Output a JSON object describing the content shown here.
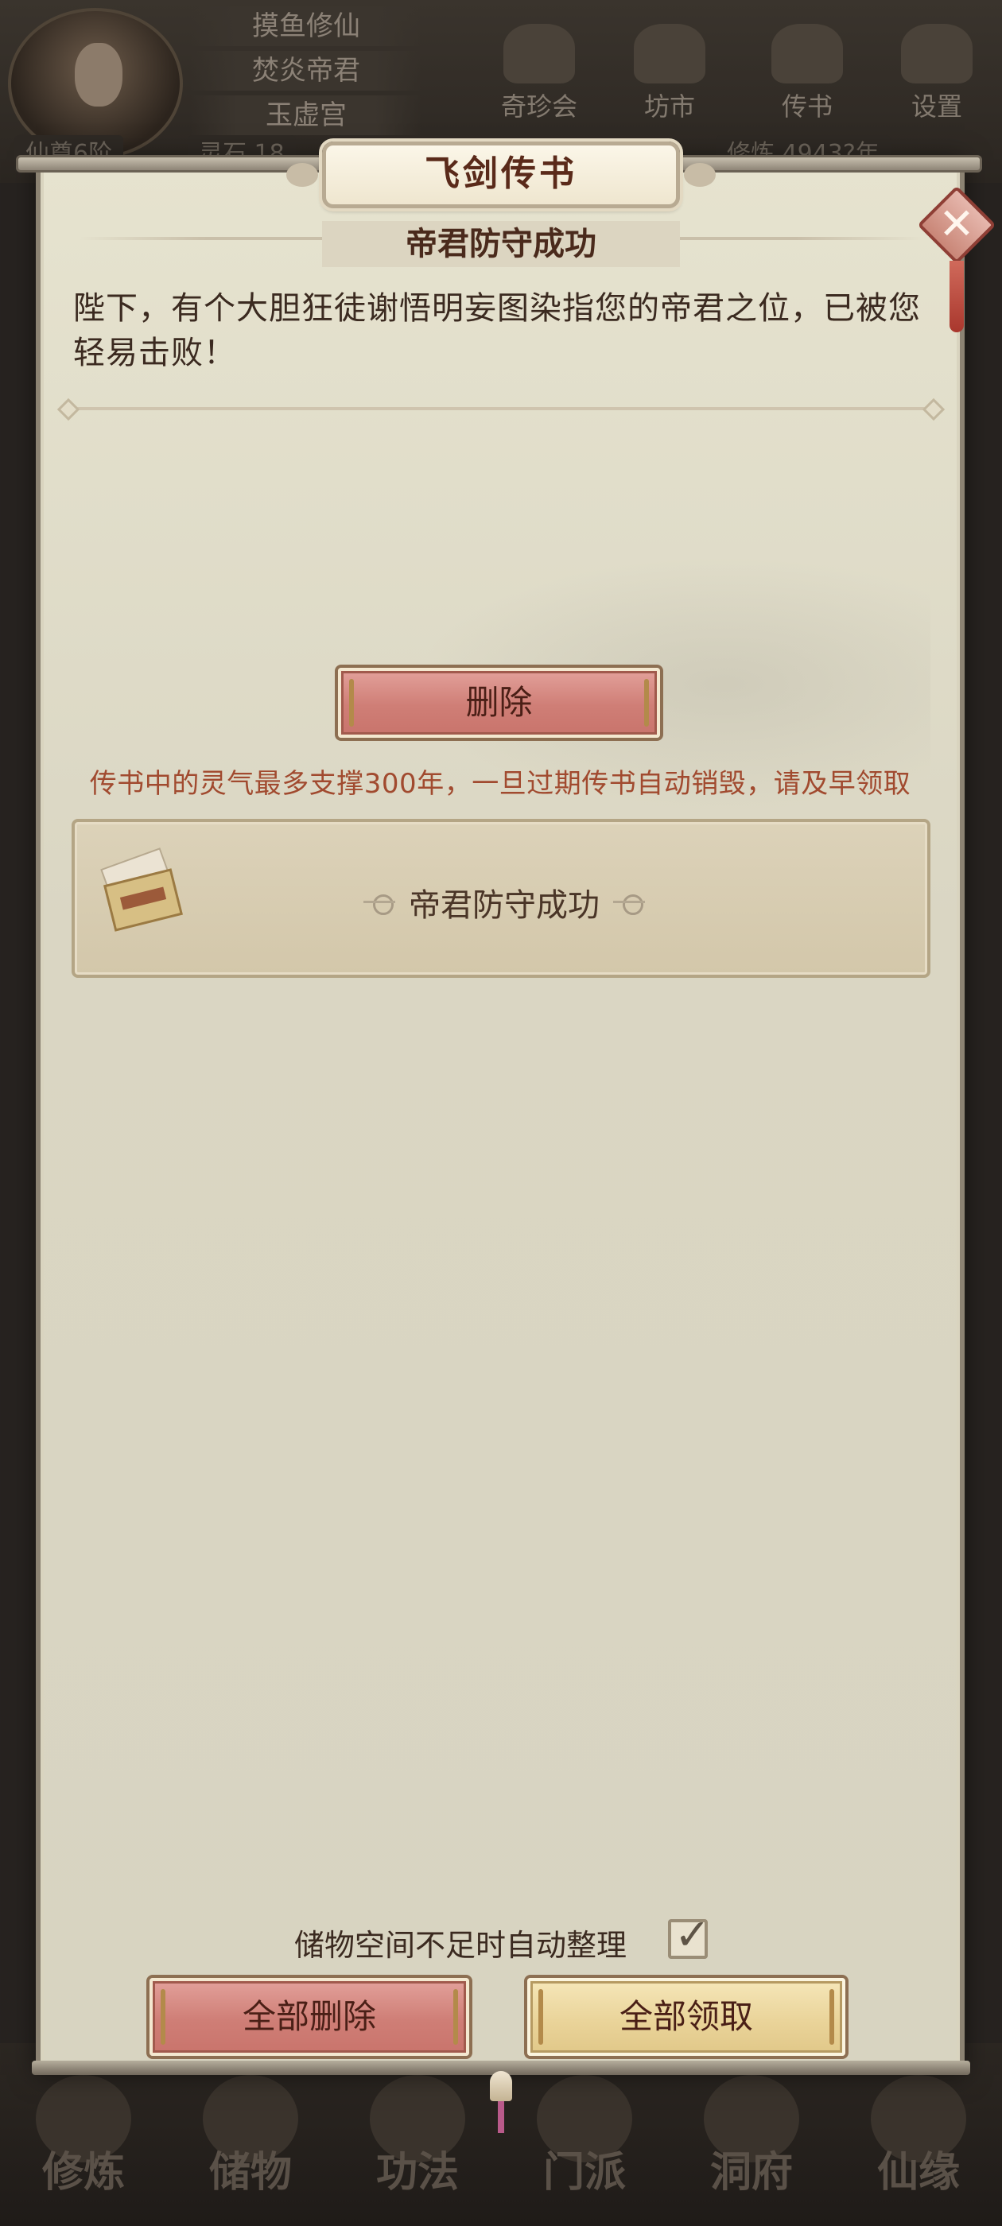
{
  "hud": {
    "player_lines": [
      "摸鱼修仙",
      "焚炎帝君",
      "玉虚宫"
    ],
    "rank_label": "仙尊6阶",
    "spirit_stone": "灵石 18",
    "cultivation": "修炼 4943?年",
    "buttons": [
      {
        "label": "奇珍会",
        "icon": "treasure-pavilion-icon"
      },
      {
        "label": "坊市",
        "icon": "market-icon"
      },
      {
        "label": "传书",
        "icon": "letter-icon"
      },
      {
        "label": "设置",
        "icon": "gear-icon"
      }
    ],
    "bottom_nav": [
      {
        "label": "修炼",
        "icon": "cultivate-icon"
      },
      {
        "label": "储物",
        "icon": "storage-bag-icon"
      },
      {
        "label": "功法",
        "icon": "technique-icon"
      },
      {
        "label": "门派",
        "icon": "sect-icon"
      },
      {
        "label": "洞府",
        "icon": "cave-dwelling-icon"
      },
      {
        "label": "仙缘",
        "icon": "destiny-icon"
      }
    ]
  },
  "dialog": {
    "title": "飞剑传书",
    "close_icon": "close-icon",
    "subject": "帝君防守成功",
    "message": "陛下，有个大胆狂徒谢悟明妄图染指您的帝君之位，已被您轻易击败！",
    "delete_label": "删除",
    "warning": "传书中的灵气最多支撑300年，一旦过期传书自动销毁，请及早领取",
    "mail_items": [
      {
        "title": "帝君防守成功",
        "icon": "letter-icon"
      }
    ],
    "auto_sort_label": "储物空间不足时自动整理",
    "auto_sort_checked": true,
    "check_mark": "✓",
    "delete_all_label": "全部删除",
    "claim_all_label": "全部领取"
  },
  "colors": {
    "red_button": "#cf7e76",
    "gold_button": "#ead49a",
    "warning_text": "#a14a2f",
    "panel": "#dad6c3"
  }
}
